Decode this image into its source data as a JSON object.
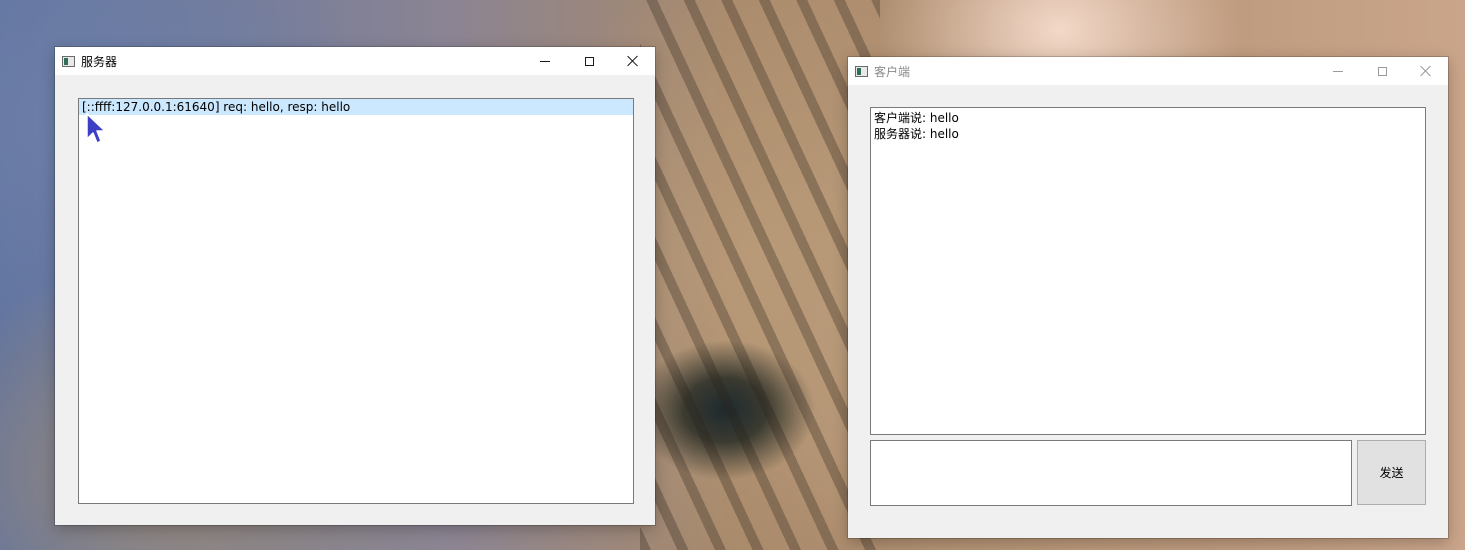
{
  "server_window": {
    "title": "服务器",
    "log_lines": [
      "[::ffff:127.0.0.1:61640] req: hello, resp: hello"
    ]
  },
  "client_window": {
    "title": "客户端",
    "chat_lines": [
      "客户端说: hello",
      "服务器说: hello"
    ],
    "message_input": "",
    "send_label": "发送"
  },
  "window_controls": {
    "minimize_icon": "minimize-icon",
    "maximize_icon": "maximize-icon",
    "close_icon": "close-icon"
  }
}
